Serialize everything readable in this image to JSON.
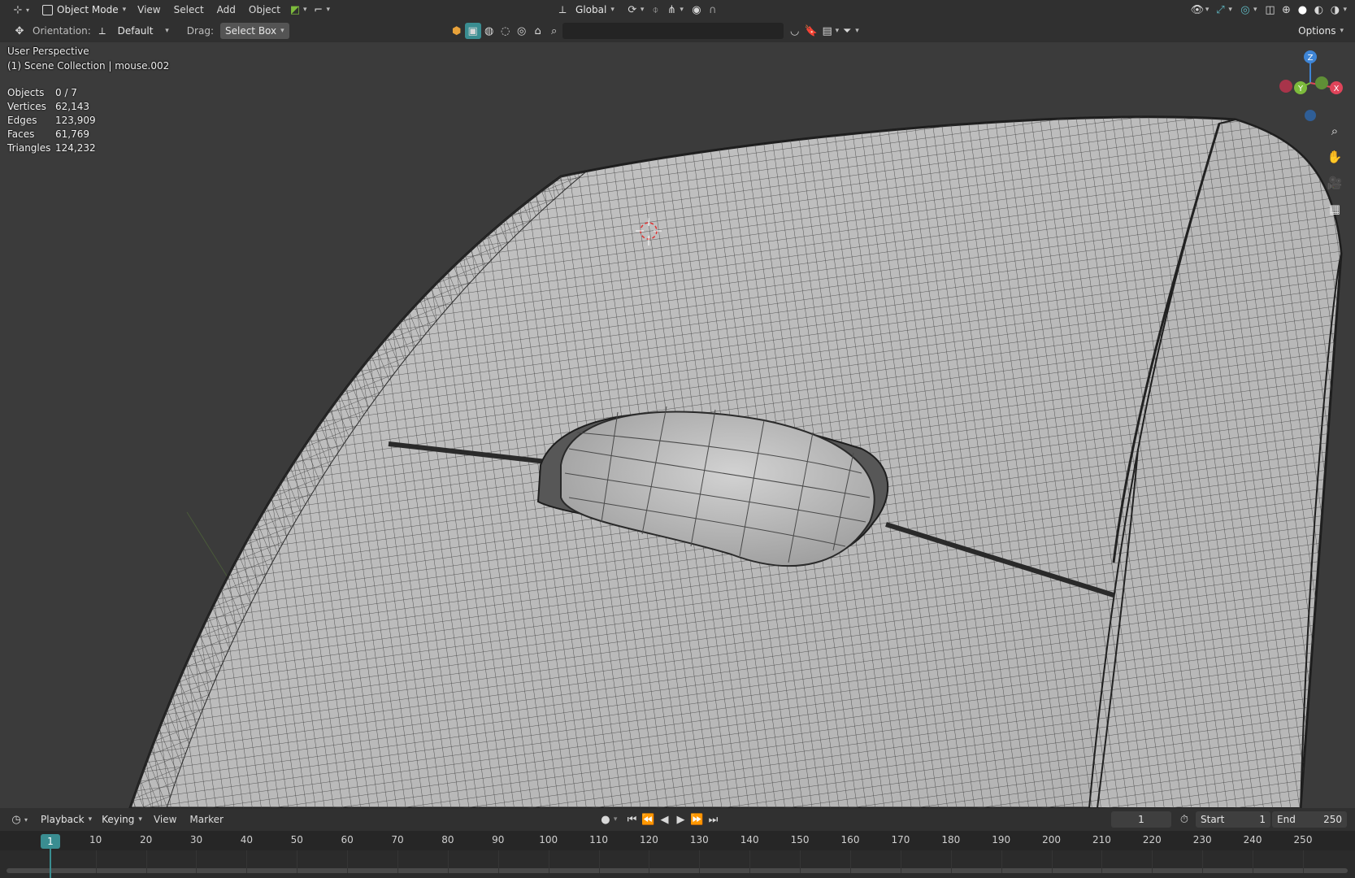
{
  "header": {
    "editor_type_icon": "viewport-editor-icon",
    "mode": "Object Mode",
    "menus": [
      "View",
      "Select",
      "Add",
      "Object"
    ],
    "transform_orientation": "Global",
    "shading_icons": [
      "wireframe-shading-icon",
      "solid-shading-icon",
      "material-shading-icon",
      "rendered-shading-icon"
    ]
  },
  "tool_header": {
    "orientation_label": "Orientation:",
    "orientation_value": "Default",
    "drag_label": "Drag:",
    "drag_value": "Select Box",
    "search_placeholder": "",
    "options_label": "Options"
  },
  "viewport": {
    "view_name": "User Perspective",
    "collection": "(1) Scene Collection | mouse.002",
    "stats": [
      {
        "key": "Objects",
        "value": "0 / 7"
      },
      {
        "key": "Vertices",
        "value": "62,143"
      },
      {
        "key": "Edges",
        "value": "123,909"
      },
      {
        "key": "Faces",
        "value": "61,769"
      },
      {
        "key": "Triangles",
        "value": "124,232"
      }
    ],
    "gizmo_axes": [
      "Z",
      "Y",
      "X"
    ],
    "colors": {
      "x_axis": "#e0445a",
      "y_axis": "#7dbb3c",
      "z_axis": "#3e85d6",
      "mesh": "#bdbdbd",
      "wire": "#2a2a2a",
      "background": "#3b3b3b"
    }
  },
  "timeline": {
    "menus": [
      "Playback",
      "Keying",
      "View",
      "Marker"
    ],
    "current_frame": "1",
    "start_label": "Start",
    "start_value": "1",
    "end_label": "End",
    "end_value": "250",
    "ticks": [
      "1",
      "10",
      "20",
      "30",
      "40",
      "50",
      "60",
      "70",
      "80",
      "90",
      "100",
      "110",
      "120",
      "130",
      "140",
      "150",
      "160",
      "170",
      "180",
      "190",
      "200",
      "210",
      "220",
      "230",
      "240",
      "250"
    ],
    "accent": "#3a8d91"
  }
}
